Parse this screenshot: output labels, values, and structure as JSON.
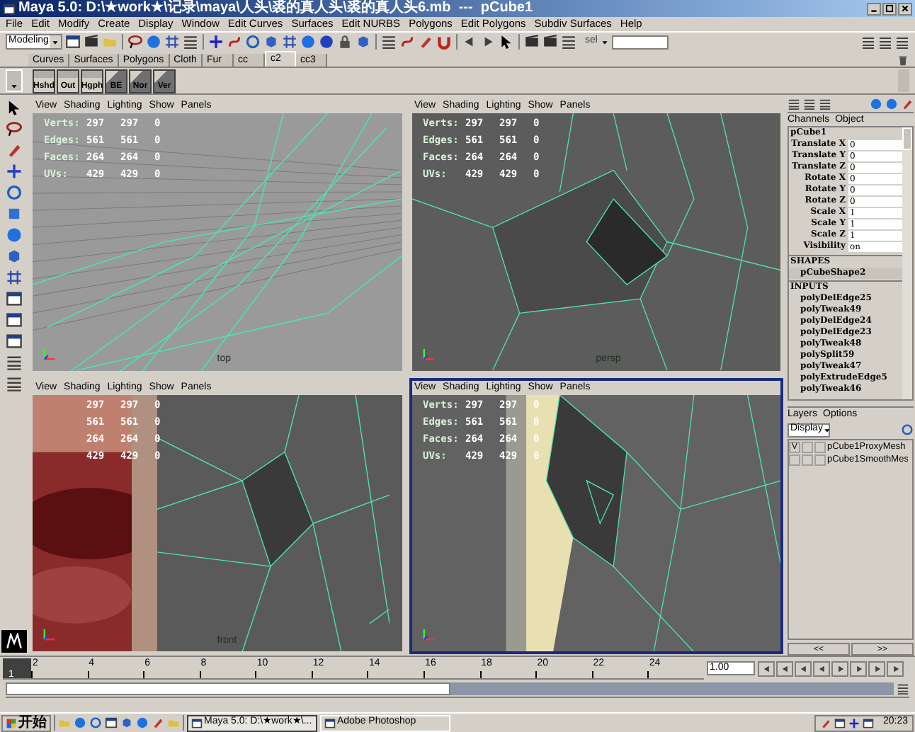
{
  "window": {
    "title": "Maya 5.0: D:\\★work★\\记录\\maya\\人头\\裘的真人头\\裘的真人头6.mb  ---  pCube1"
  },
  "menu_bar": [
    "File",
    "Edit",
    "Modify",
    "Create",
    "Display",
    "Window",
    "Edit Curves",
    "Surfaces",
    "Edit NURBS",
    "Polygons",
    "Edit Polygons",
    "Subdiv Surfaces",
    "Help"
  ],
  "status_line": {
    "mode": "Modeling",
    "selection_label": "sel"
  },
  "shelf": {
    "tabs": [
      {
        "label": "Curves",
        "selected": false
      },
      {
        "label": "Surfaces",
        "selected": false
      },
      {
        "label": "Polygons",
        "selected": false
      },
      {
        "label": "Cloth",
        "selected": false
      },
      {
        "label": "Fur",
        "selected": false
      },
      {
        "label": "cc",
        "selected": false
      },
      {
        "label": "c2",
        "selected": true
      },
      {
        "label": "cc3",
        "selected": false
      }
    ],
    "buttons": [
      {
        "label": "Hshd",
        "kind": "flat"
      },
      {
        "label": "Out",
        "kind": "flat"
      },
      {
        "label": "Hgph",
        "kind": "flat"
      },
      {
        "label": "BE",
        "kind": "slant"
      },
      {
        "label": "Nor",
        "kind": "slant"
      },
      {
        "label": "Ver",
        "kind": "slant"
      }
    ]
  },
  "viewports": [
    {
      "menu": [
        "View",
        "Shading",
        "Lighting",
        "Show",
        "Panels"
      ],
      "kind": "top",
      "active": false,
      "camera": "top",
      "stats": [
        {
          "label": "Verts:",
          "values": [
            "297",
            "297",
            "0"
          ]
        },
        {
          "label": "Edges:",
          "values": [
            "561",
            "561",
            "0"
          ]
        },
        {
          "label": "Faces:",
          "values": [
            "264",
            "264",
            "0"
          ]
        },
        {
          "label": "UVs:",
          "values": [
            "429",
            "429",
            "0"
          ]
        }
      ]
    },
    {
      "menu": [
        "View",
        "Shading",
        "Lighting",
        "Show",
        "Panels"
      ],
      "kind": "persp",
      "active": false,
      "camera": "persp",
      "stats": [
        {
          "label": "Verts:",
          "values": [
            "297",
            "297",
            "0"
          ]
        },
        {
          "label": "Edges:",
          "values": [
            "561",
            "561",
            "0"
          ]
        },
        {
          "label": "Faces:",
          "values": [
            "264",
            "264",
            "0"
          ]
        },
        {
          "label": "UVs:",
          "values": [
            "429",
            "429",
            "0"
          ]
        }
      ]
    },
    {
      "menu": [
        "View",
        "Shading",
        "Lighting",
        "Show",
        "Panels"
      ],
      "kind": "textured",
      "active": false,
      "camera": "front",
      "stats": [
        {
          "values": [
            "297",
            "297",
            "0"
          ]
        },
        {
          "values": [
            "561",
            "561",
            "0"
          ]
        },
        {
          "values": [
            "264",
            "264",
            "0"
          ]
        },
        {
          "values": [
            "429",
            "429",
            "0"
          ]
        }
      ]
    },
    {
      "menu": [
        "View",
        "Shading",
        "Lighting",
        "Show",
        "Panels"
      ],
      "kind": "side",
      "active": true,
      "stats": [
        {
          "label": "Verts:",
          "values": [
            "297",
            "297",
            "0"
          ]
        },
        {
          "label": "Edges:",
          "values": [
            "561",
            "561",
            "0"
          ]
        },
        {
          "label": "Faces:",
          "values": [
            "264",
            "264",
            "0"
          ]
        },
        {
          "label": "UVs:",
          "values": [
            "429",
            "429",
            "0"
          ]
        }
      ]
    }
  ],
  "channel_box": {
    "tabs": [
      "Channels",
      "Object"
    ],
    "object": "pCube1",
    "attributes": [
      {
        "name": "Translate X",
        "value": "0"
      },
      {
        "name": "Translate Y",
        "value": "0"
      },
      {
        "name": "Translate Z",
        "value": "0"
      },
      {
        "name": "Rotate X",
        "value": "0"
      },
      {
        "name": "Rotate Y",
        "value": "0"
      },
      {
        "name": "Rotate Z",
        "value": "0"
      },
      {
        "name": "Scale X",
        "value": "1"
      },
      {
        "name": "Scale Y",
        "value": "1"
      },
      {
        "name": "Scale Z",
        "value": "1"
      },
      {
        "name": "Visibility",
        "value": "on"
      }
    ],
    "shapes_heading": "SHAPES",
    "shapes": [
      "pCubeShape2"
    ],
    "inputs_heading": "INPUTS",
    "inputs": [
      "polyDelEdge25",
      "polyTweak49",
      "polyDelEdge24",
      "polyDelEdge23",
      "polyTweak48",
      "polySplit59",
      "polyTweak47",
      "polyExtrudeEdge5",
      "polyTweak46"
    ]
  },
  "layers": {
    "menu": [
      "Layers",
      "Options"
    ],
    "mode": "Display",
    "items": [
      {
        "visibility": "V",
        "name": "pCube1ProxyMesh"
      },
      {
        "name": "pCube1SmoothMes"
      }
    ],
    "scroll_buttons": [
      "<<",
      ">>"
    ]
  },
  "time_slider": {
    "current_frame": "1",
    "level": 0,
    "ticks": [
      "2",
      "4",
      "6",
      "8",
      "10",
      "12",
      "14",
      "16",
      "18",
      "20",
      "22",
      "24"
    ],
    "time": "1.00"
  },
  "range_slider": {
    "level": 0.5
  },
  "taskbar": {
    "start": "开始",
    "tasks": [
      {
        "label": "Maya 5.0: D:\\★work★\\...",
        "selected": true
      },
      {
        "label": "Adobe Photoshop",
        "selected": false
      }
    ],
    "clock": "20:23"
  }
}
